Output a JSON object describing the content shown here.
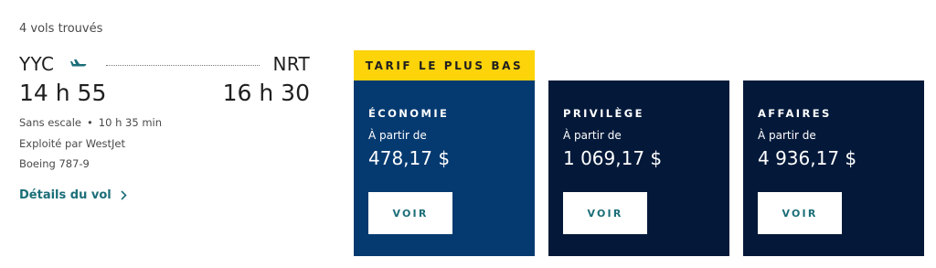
{
  "results_count": "4 vols trouvés",
  "flight": {
    "origin": "YYC",
    "destination": "NRT",
    "departure_time": "14 h 55",
    "arrival_time": "16 h 30",
    "stops": "Sans escale",
    "duration": "10 h 35 min",
    "operated_by": "Exploité par WestJet",
    "aircraft": "Boeing 787-9",
    "details_link": "Détails du vol"
  },
  "icons": {
    "plane": "airplane-icon",
    "chevron": "chevron-right-icon"
  },
  "colors": {
    "accent": "#1b6e78",
    "banner": "#fdd30a",
    "economy_bg": "#053a70",
    "premium_bg": "#04193a",
    "business_bg": "#04193a"
  },
  "banner": "TARIF LE PLUS BAS",
  "fares": [
    {
      "cabin": "ÉCONOMIE",
      "from_label": "À partir de",
      "price": "478,17 $",
      "button": "VOIR"
    },
    {
      "cabin": "PRIVILÈGE",
      "from_label": "À partir de",
      "price": "1 069,17 $",
      "button": "VOIR"
    },
    {
      "cabin": "AFFAIRES",
      "from_label": "À partir de",
      "price": "4 936,17 $",
      "button": "VOIR"
    }
  ]
}
